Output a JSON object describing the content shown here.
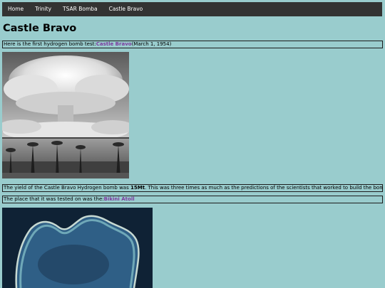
{
  "nav": {
    "items": [
      {
        "label": "Home"
      },
      {
        "label": "Trinity"
      },
      {
        "label": "TSAR Bomba"
      },
      {
        "label": "Castle Bravo"
      }
    ]
  },
  "page": {
    "title": "Castle Bravo"
  },
  "intro": {
    "prefix": "Here is the first hydrogen bomb test:",
    "link": "Castle Bravo",
    "suffix": "(March 1, 1954)"
  },
  "yield": {
    "prefix": "The yield of the Castle Bravo Hydrogen bomb was ",
    "value": "15Mt",
    "suffix": ". This was three times as much as the predictions of the scientists that worked to build the bomb ."
  },
  "location": {
    "prefix": "The place that it was tested on was the:",
    "link": "Bikini Atoll"
  },
  "colors": {
    "background": "#99cccd",
    "nav": "#333333",
    "link": "#7c3a9e"
  }
}
